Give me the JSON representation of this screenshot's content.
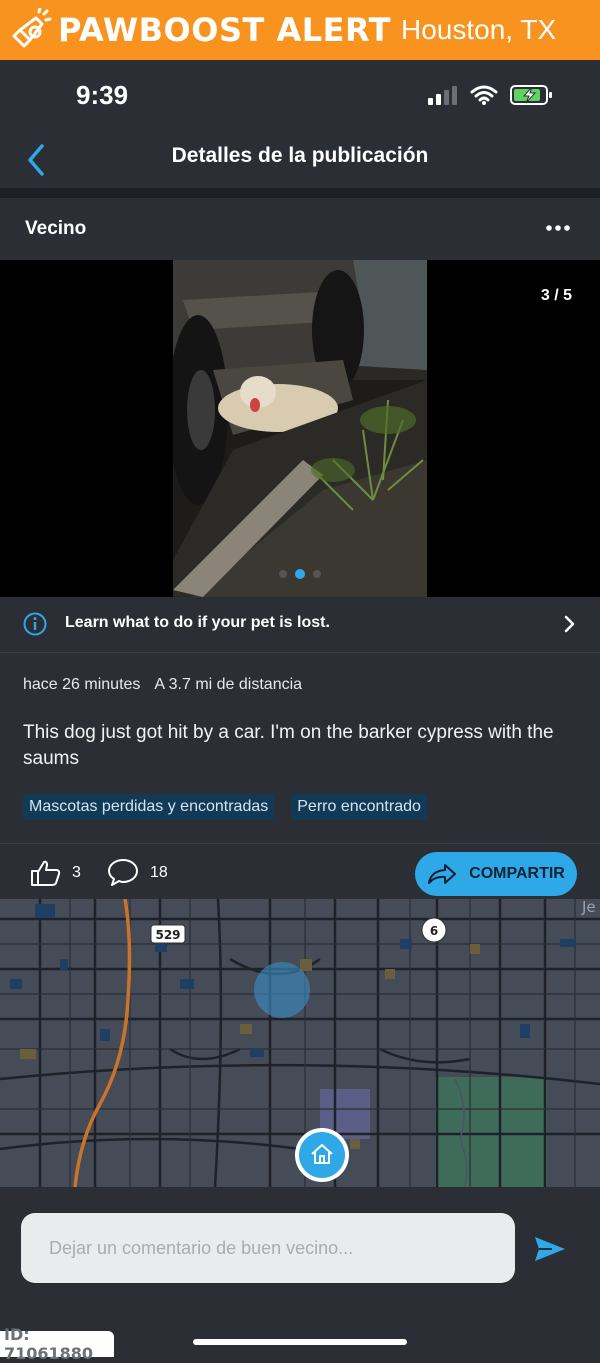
{
  "banner": {
    "brand": "PAWBOOST ALERT",
    "city": "Houston, TX",
    "icon": "megaphone-icon"
  },
  "status": {
    "time": "9:39",
    "icons": [
      "signal-icon",
      "wifi-icon",
      "battery-charging-icon"
    ]
  },
  "nav": {
    "title": "Detalles de la publicación",
    "back_icon": "chevron-left-icon"
  },
  "post": {
    "author": "Vecino",
    "more_icon": "more-horizontal-icon",
    "photo_counter": "3 / 5",
    "photo_current": 3,
    "photo_total": 5,
    "learn_text": "Learn what to do if your pet is lost.",
    "time_ago": "hace 26 minutes",
    "distance": "A 3.7 mi de distancia",
    "text": "This dog just got hit by a car. I'm on the barker cypress with the saums",
    "tags": [
      "Mascotas perdidas y encontradas",
      "Perro encontrado"
    ],
    "likes": "3",
    "comments": "18",
    "share_label": "COMPARTIR"
  },
  "map": {
    "labels": [
      "529",
      "6",
      "Je"
    ]
  },
  "comment": {
    "placeholder": "Dejar un comentario de buen vecino..."
  },
  "footer": {
    "id_label": "ID: 71061880"
  },
  "colors": {
    "banner": "#f7931e",
    "accent": "#2fa8e8",
    "background": "#2b2f35",
    "tag_bg": "#123a55"
  }
}
